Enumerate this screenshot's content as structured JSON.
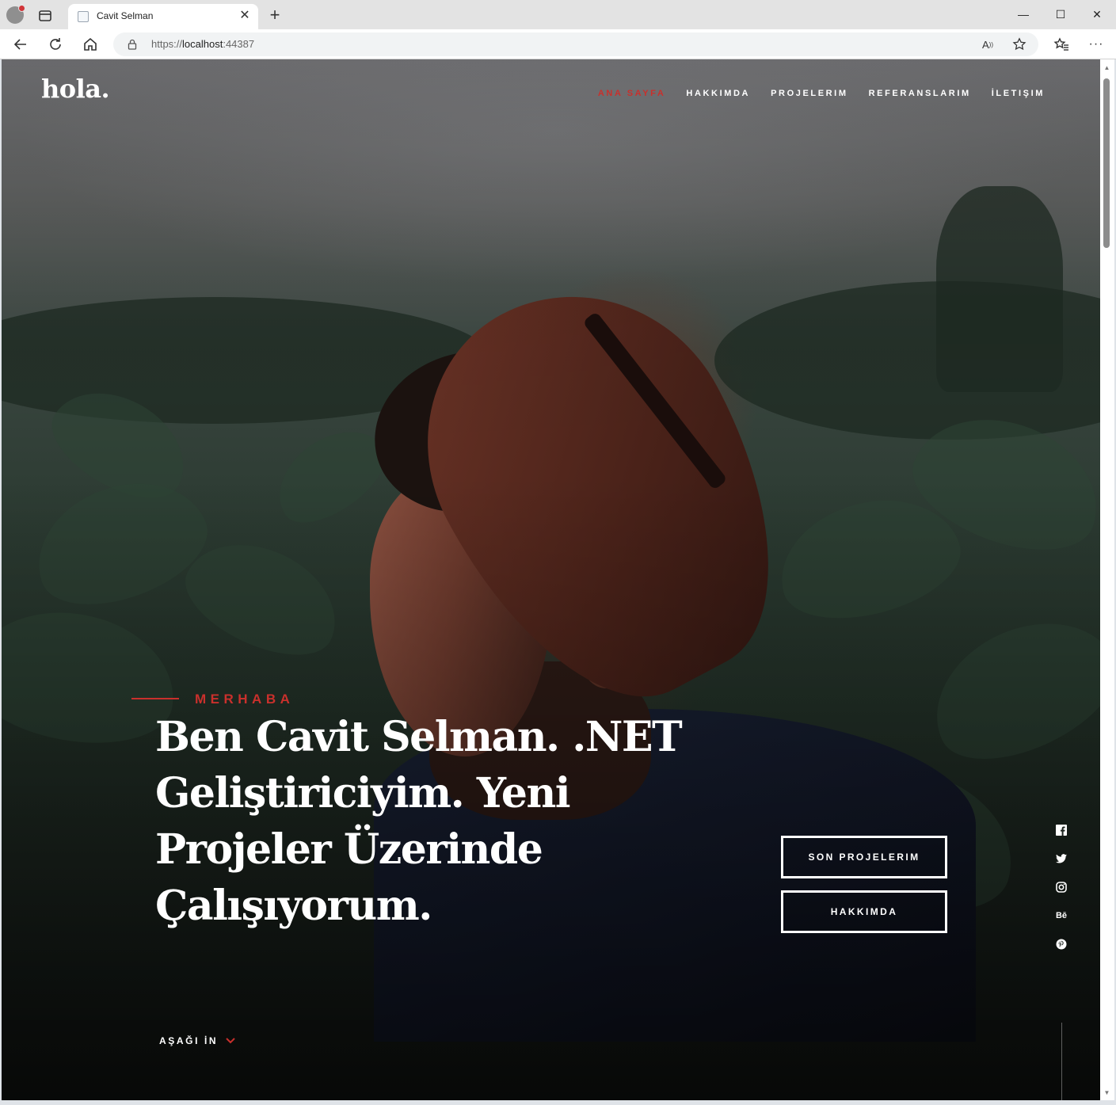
{
  "browser": {
    "tab_title": "Cavit Selman",
    "url_prefix": "https://",
    "url_host": "localhost",
    "url_port": ":44387",
    "icons": [
      "profile-icon",
      "tab-actions-icon",
      "back-icon",
      "refresh-icon",
      "home-icon",
      "lock-icon",
      "read-aloud-icon",
      "favorite-star-icon",
      "favorites-icon",
      "more-icon",
      "minimize-icon",
      "maximize-icon",
      "close-icon"
    ]
  },
  "site": {
    "logo": "hola.",
    "nav": [
      {
        "label": "ANA SAYFA",
        "active": true
      },
      {
        "label": "HAKKIMDA",
        "active": false
      },
      {
        "label": "PROJELERIM",
        "active": false
      },
      {
        "label": "REFERANSLARIM",
        "active": false
      },
      {
        "label": "İLETIŞIM",
        "active": false
      }
    ],
    "accent_color": "#c9302c"
  },
  "hero": {
    "pretitle": "MERHABA",
    "headline": "Ben Cavit Selman. .NET Geliştiriciyim. Yeni Projeler Üzerinde Çalışıyorum.",
    "buttons": [
      "SON PROJELERIM",
      "HAKKIMDA"
    ],
    "social": [
      "facebook-icon",
      "twitter-icon",
      "instagram-icon",
      "behance-icon",
      "pinterest-icon"
    ],
    "scroll_label": "AŞAĞI İN"
  }
}
